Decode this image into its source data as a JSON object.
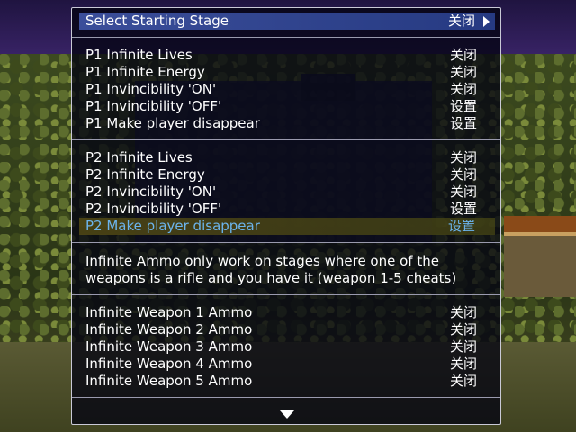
{
  "menu": {
    "stage": {
      "label": "Select Starting Stage",
      "value": "关闭"
    },
    "p1": [
      {
        "label": "P1 Infinite Lives",
        "value": "关闭"
      },
      {
        "label": "P1 Infinite Energy",
        "value": "关闭"
      },
      {
        "label": "P1 Invincibility 'ON'",
        "value": "关闭"
      },
      {
        "label": "P1 Invincibility 'OFF'",
        "value": "设置"
      },
      {
        "label": "P1 Make player disappear",
        "value": "设置"
      }
    ],
    "p2": [
      {
        "label": "P2 Infinite Lives",
        "value": "关闭"
      },
      {
        "label": "P2 Infinite Energy",
        "value": "关闭"
      },
      {
        "label": "P2 Invincibility 'ON'",
        "value": "关闭"
      },
      {
        "label": "P2 Invincibility 'OFF'",
        "value": "设置"
      },
      {
        "label": "P2 Make player disappear",
        "value": "设置"
      }
    ],
    "note_line1": "Infinite Ammo only work on stages where one of the",
    "note_line2": "weapons is a rifle and you have it (weapon 1-5 cheats)",
    "weapons": [
      {
        "label": "Infinite Weapon 1 Ammo",
        "value": "关闭"
      },
      {
        "label": "Infinite Weapon 2 Ammo",
        "value": "关闭"
      },
      {
        "label": "Infinite Weapon 3 Ammo",
        "value": "关闭"
      },
      {
        "label": "Infinite Weapon 4 Ammo",
        "value": "关闭"
      },
      {
        "label": "Infinite Weapon 5 Ammo",
        "value": "关闭"
      }
    ]
  },
  "icons": {
    "more_right": "triangle-right-icon",
    "scroll_down": "triangle-down-icon"
  },
  "colors": {
    "selected": "#2f4590",
    "highlight_text": "#6cb4ec",
    "text": "#ffffff"
  }
}
